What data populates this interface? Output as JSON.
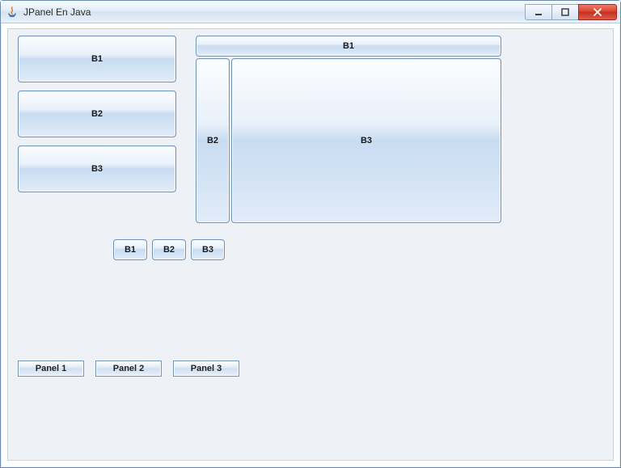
{
  "window": {
    "title": "JPanel En Java"
  },
  "left_group": {
    "b1": "B1",
    "b2": "B2",
    "b3": "B3"
  },
  "border_group": {
    "top": "B1",
    "left": "B2",
    "center": "B3"
  },
  "flow_group": {
    "b1": "B1",
    "b2": "B2",
    "b3": "B3"
  },
  "panels": {
    "p1": "Panel 1",
    "p2": "Panel 2",
    "p3": "Panel 3"
  }
}
